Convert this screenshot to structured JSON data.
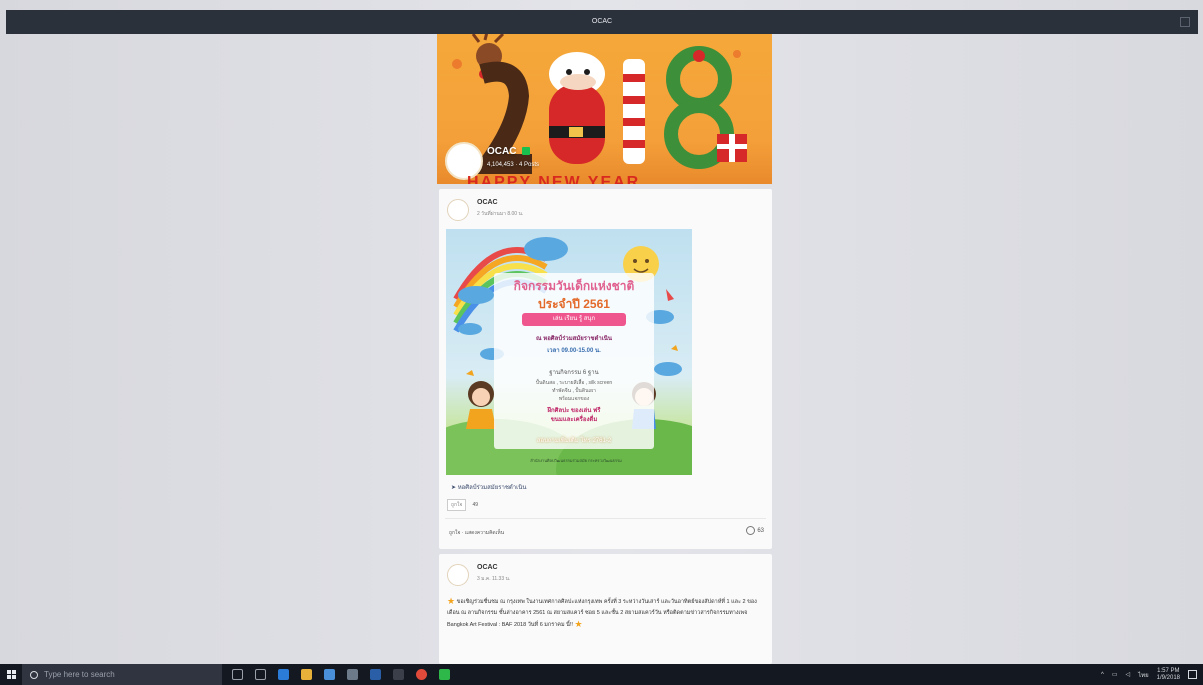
{
  "window": {
    "title": "OCAC"
  },
  "cover": {
    "page_name": "OCAC",
    "stats": "4,104,453 · 4 Posts",
    "banner_text": "HAPPY NEW YEAR",
    "year_art": "2018"
  },
  "posts": [
    {
      "author": "OCAC",
      "time": "2 วันที่ผ่านมา 8.00 น.",
      "poster": {
        "title": "กิจกรรมวันเด็กแห่งชาติ",
        "year": "ประจำปี 2561",
        "pill": "เล่น เรียน รู้ สนุก",
        "venue": "ณ หอศิลป์ร่วมสมัยราชดำเนิน",
        "hours": "เวลา 09.00-15.00 น.",
        "prize": "ฐานกิจกรรม 6 ฐาน",
        "items": "ปั้นดินสอ , ระบายสีเสื้อ , silk screen\nทำพัดจีน , ปั้นดินเผา\nพร้อมแจกของ",
        "free": "ฝึกศิลปะ ของเล่น ฟรี\nขนมและเครื่องดื่ม",
        "contact": "สอบถามเพิ่มเติม โทร 2761-2",
        "footer": "สำนักงานศิลปวัฒนธรรมร่วมสมัย กระทรวงวัฒนธรรม"
      },
      "location": "หอศิลป์ร่วมสมัยราชดำเนิน",
      "reaction_label": "ถูกใจ",
      "reaction_count": "49",
      "like_action": "ถูกใจ · แสดงความคิดเห็น",
      "comment_count": "63"
    },
    {
      "author": "OCAC",
      "time": "3 ม.ค. 11.33 น.",
      "body": "ขอเชิญร่วมชื่นชม ณ กรุงเทพ ในงานเทศกาลศิลปะแห่งกรุงเทพ ครั้งที่ 3 ระหว่างวันเสาร์ และวันอาทิตย์ของสัปดาห์ที่ 1 และ 2 ของเดือน ณ ลานกิจกรรม ชั้นล่างอาคาร 2561 ณ สยามสแควร์ ซอย 5 และชั้น 2 สยามสแควร์วัน หรือติดตามข่าวสารกิจกรรมทางเพจ Bangkok Art Festival : BAF 2018 วันที่ 6 มกราคม นี้!!"
    }
  ],
  "taskbar": {
    "search_placeholder": "Type here to search",
    "language": "ไทย",
    "time": "1:57 PM",
    "date": "1/9/2018"
  },
  "colors": {
    "title_bar": "#2b313b",
    "taskbar": "#141820",
    "accent_orange": "#f4a03a",
    "brand_pink": "#f0568e"
  }
}
